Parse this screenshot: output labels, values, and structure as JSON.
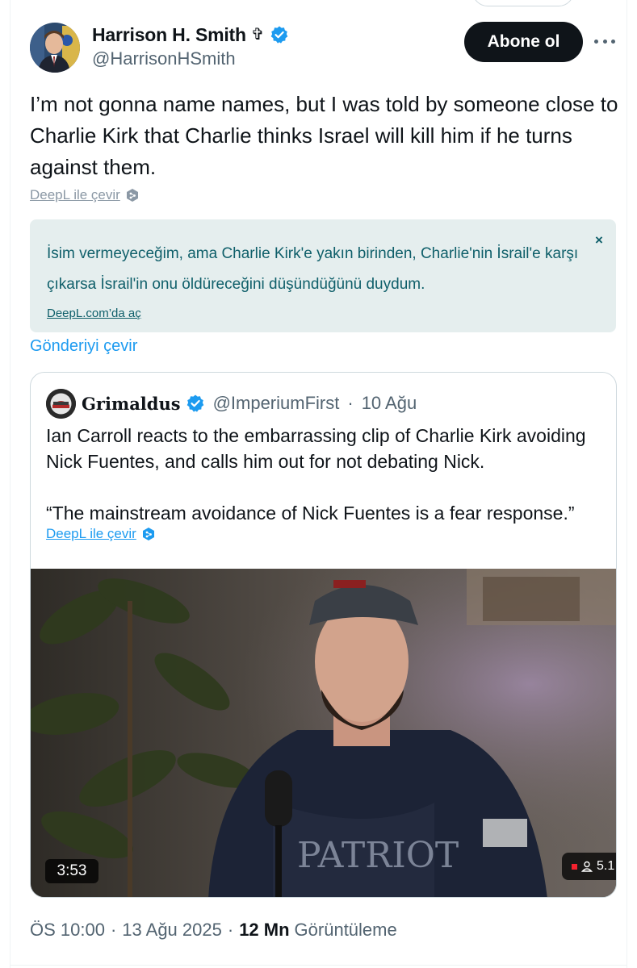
{
  "author": {
    "name": "Harrison H. Smith",
    "name_suffix_glyph": "✞",
    "handle": "@HarrisonHSmith",
    "verified": true
  },
  "actions": {
    "subscribe_label": "Abone ol"
  },
  "tweet": {
    "text": "I’m not gonna name names, but I was told by someone close to Charlie Kirk that Charlie thinks Israel will kill him if he turns against them.",
    "deepl_link": "DeepL ile çevir",
    "translation": {
      "text": "İsim vermeyeceğim, ama Charlie Kirk'e yakın birinden, Charlie'nin İsrail'e karşı çıkarsa İsrail'in onu öldüreceğini düşündüğünü duydum.",
      "open_link": "DeepL.com’da aç",
      "close_glyph": "×"
    },
    "translate_post": "Gönderiyi çevir"
  },
  "quote": {
    "name": "Grimaldus",
    "handle": "@ImperiumFirst",
    "date": "10 Ağu",
    "meta_separator": "·",
    "paragraph1": "Ian Carroll reacts to the embarrassing clip of Charlie Kirk avoiding Nick Fuentes, and calls him out for not debating Nick.",
    "paragraph2": "“The mainstream avoidance of Nick Fuentes is a fear response.”",
    "deepl_link": "DeepL ile çevir",
    "video": {
      "duration": "3:53",
      "viewers": "5.1"
    }
  },
  "footer": {
    "time": "ÖS 10:00",
    "date": "13 Ağu 2025",
    "views": "12 Mn",
    "views_label": "Görüntüleme",
    "separator": "·"
  },
  "colors": {
    "accent": "#1d9bf0",
    "text_primary": "#0f1419",
    "text_secondary": "#536471",
    "translation_bg": "#e5eeee",
    "translation_text": "#0f5f6a",
    "button_bg": "#0f1419"
  },
  "icons": {
    "verified": "verified-badge-icon",
    "more": "more-horizontal-icon",
    "deepl": "deepl-icon",
    "close": "close-icon"
  }
}
